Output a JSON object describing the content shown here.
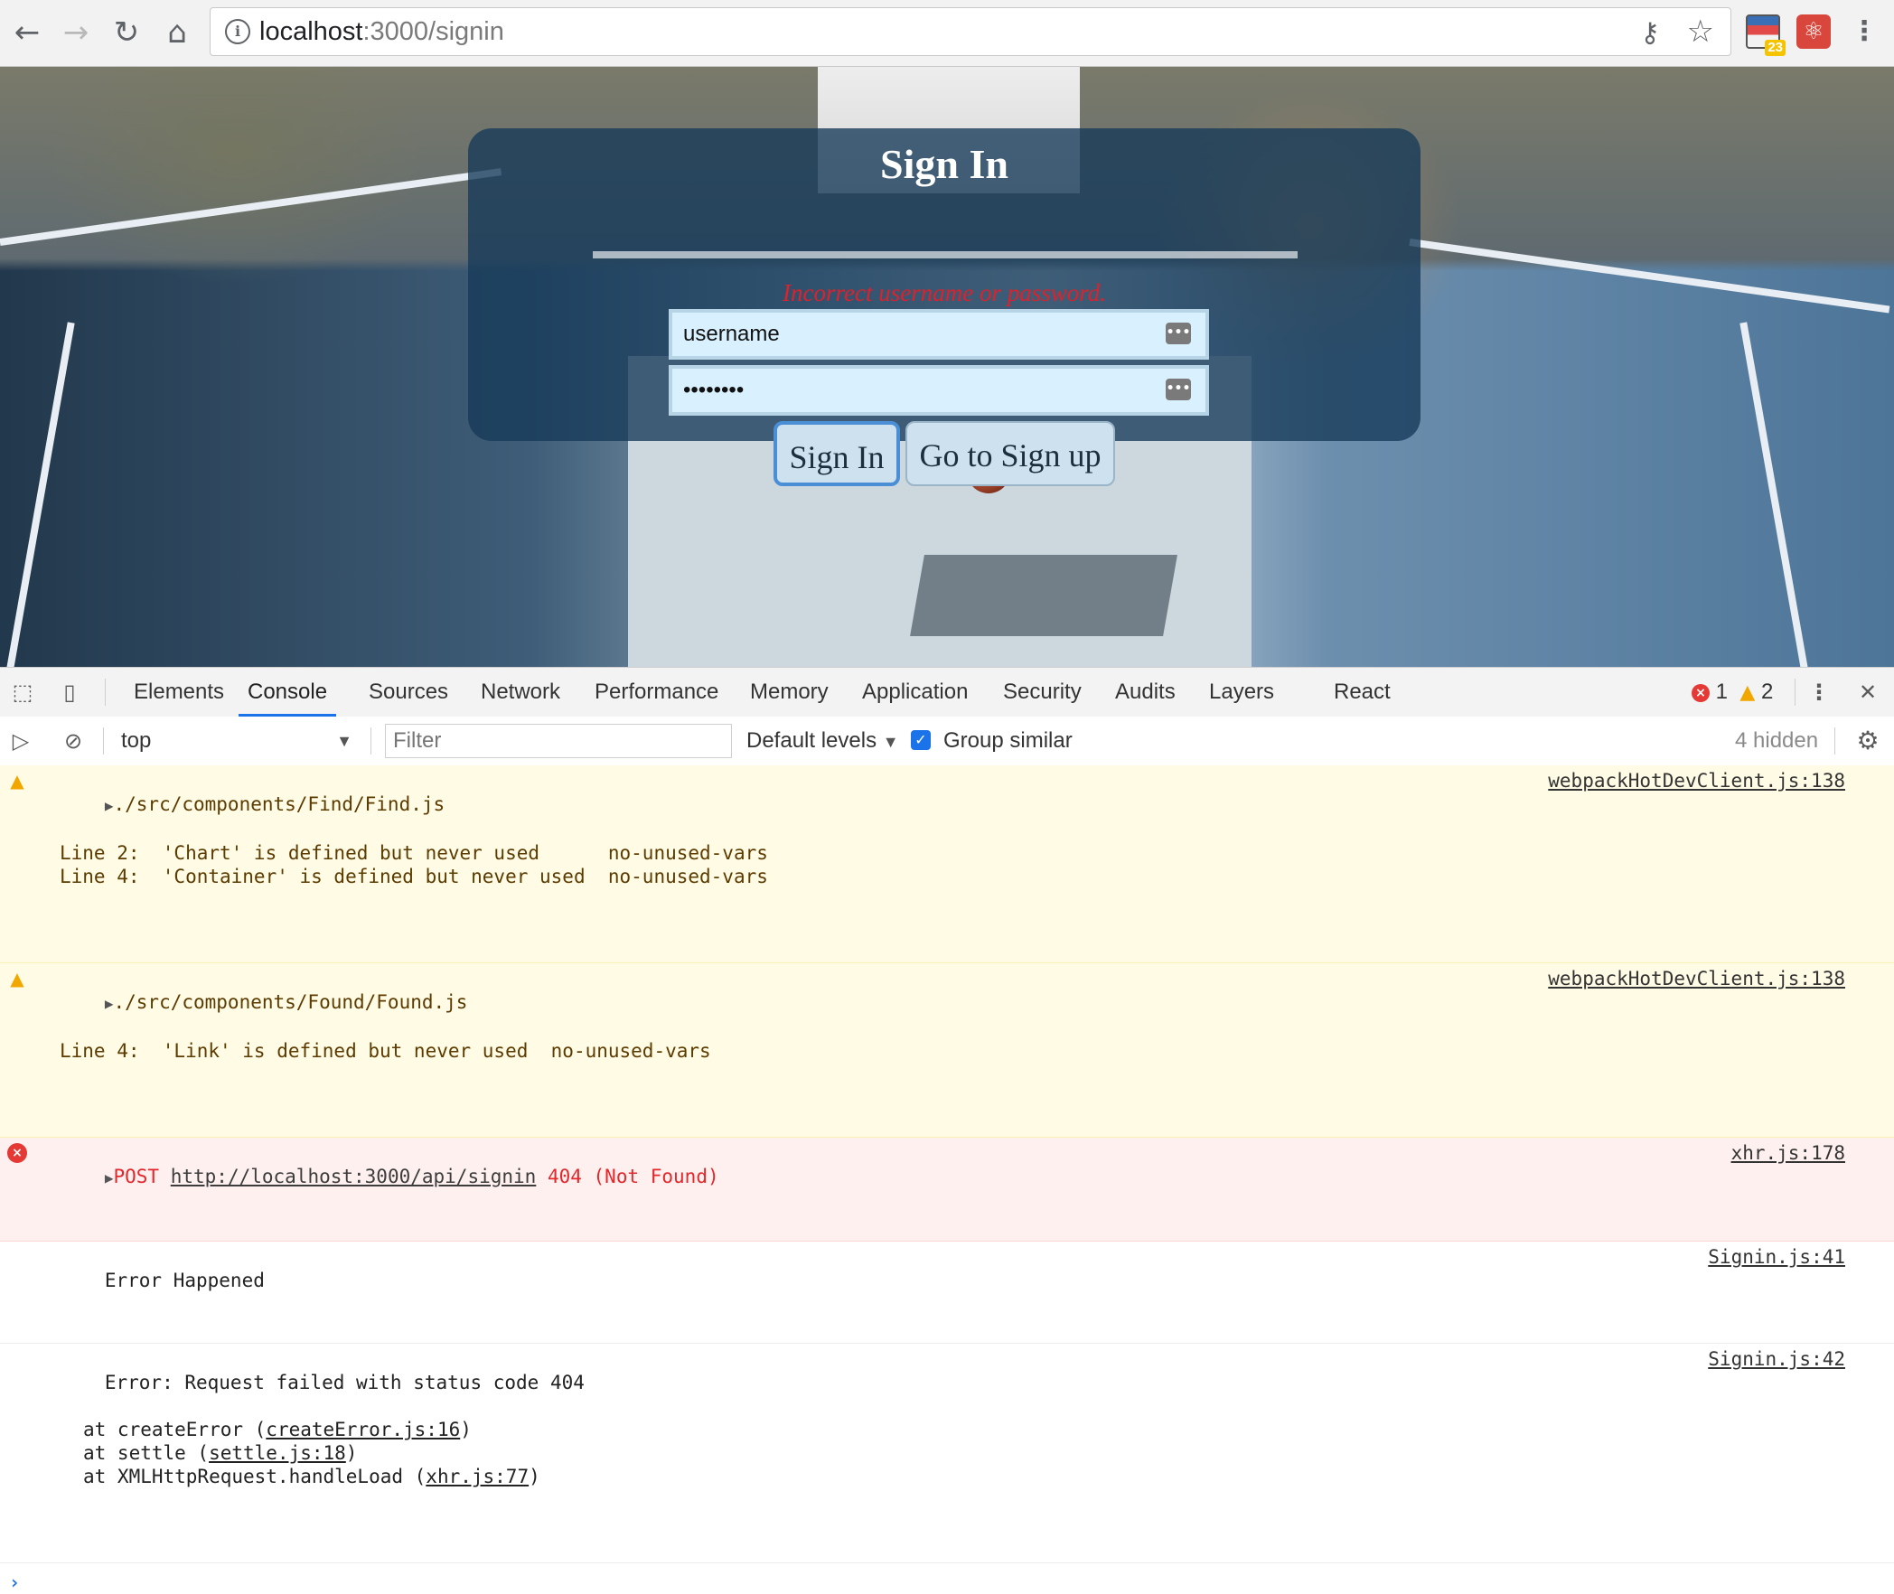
{
  "browser": {
    "url_host": "localhost",
    "url_rest": ":3000/signin",
    "extension_badge": "23"
  },
  "signin": {
    "title": "Sign In",
    "error": "Incorrect username or password.",
    "username_value": "username",
    "password_value": "password",
    "signin_button": "Sign In",
    "signup_button": "Go to Sign up"
  },
  "devtools": {
    "tabs": [
      "Elements",
      "Console",
      "Sources",
      "Network",
      "Performance",
      "Memory",
      "Application",
      "Security",
      "Audits",
      "Layers",
      "React"
    ],
    "active_tab": "Console",
    "error_count": "1",
    "warning_count": "2",
    "context": "top",
    "filter_placeholder": "Filter",
    "levels": "Default levels",
    "group_similar": "Group similar",
    "hidden": "4 hidden"
  },
  "console": {
    "warn1": {
      "file": "./src/components/Find/Find.js",
      "line_a": "Line 2:  'Chart' is defined but never used      no-unused-vars",
      "line_b": "Line 4:  'Container' is defined but never used  no-unused-vars",
      "source": "webpackHotDevClient.js:138"
    },
    "warn2": {
      "file": "./src/components/Found/Found.js",
      "line_a": "Line 4:  'Link' is defined but never used  no-unused-vars",
      "source": "webpackHotDevClient.js:138"
    },
    "error1": {
      "method": "POST",
      "url": "http://localhost:3000/api/signin",
      "status": "404 (Not Found)",
      "source": "xhr.js:178"
    },
    "log1": {
      "text": "Error Happened",
      "source": "Signin.js:41"
    },
    "log2": {
      "text": "Error: Request failed with status code 404",
      "at1_pre": "at createError (",
      "at1_link": "createError.js:16",
      "at2_pre": "at settle (",
      "at2_link": "settle.js:18",
      "at3_pre": "at XMLHttpRequest.handleLoad (",
      "at3_link": "xhr.js:77",
      "close": ")",
      "source": "Signin.js:42"
    },
    "prompt": "›"
  }
}
